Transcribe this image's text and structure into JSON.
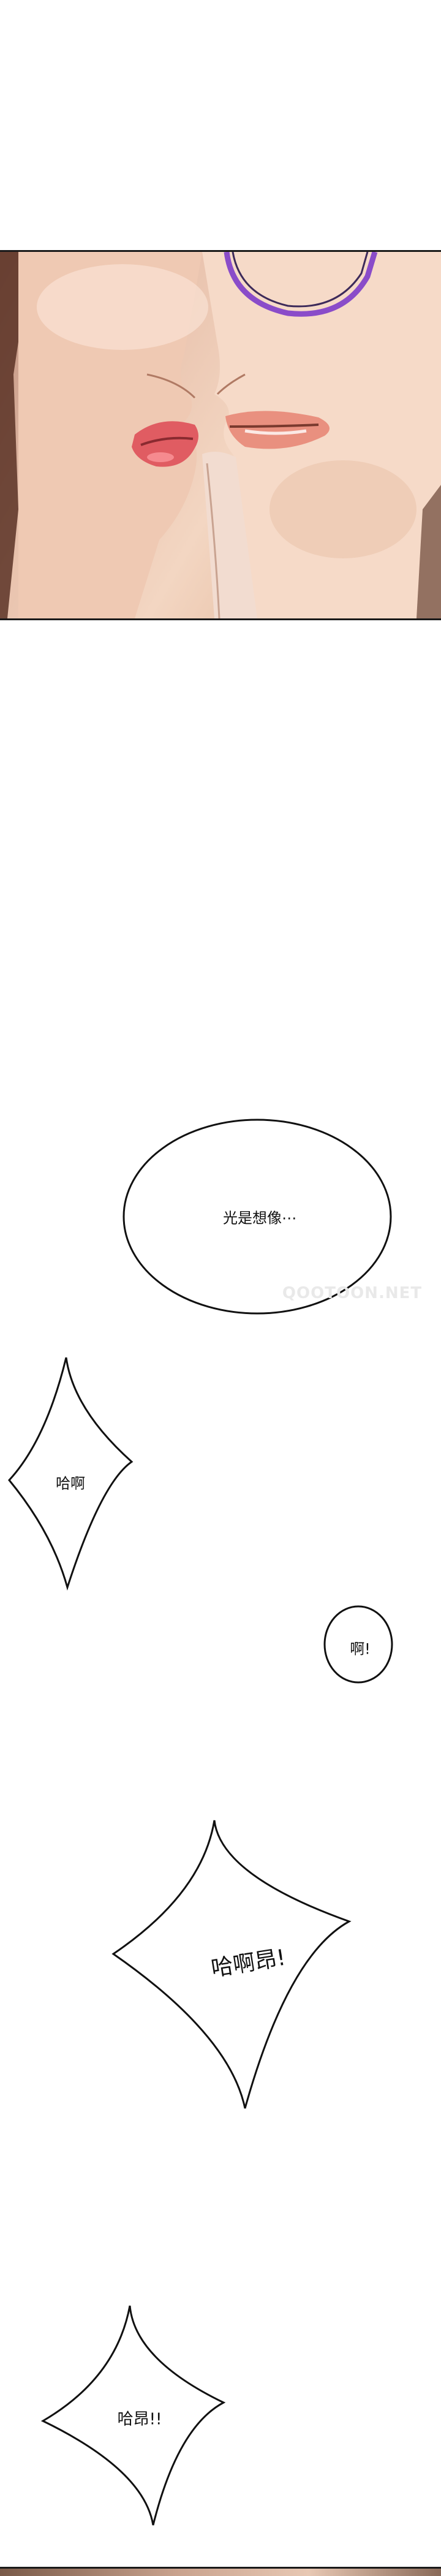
{
  "bubbles": {
    "thought": "光是想像⋯",
    "gasp1": "哈啊",
    "gasp2": "啊!",
    "gasp3": "哈啊昂!",
    "gasp4": "哈昂!!"
  },
  "watermark": "QOOTOON.NET",
  "colors": {
    "skin_light": "#f3d6c2",
    "skin_mid": "#e6bda2",
    "lips": "#e05c62",
    "glasses": "#8a4cc9",
    "outline": "#1a1a1a"
  }
}
